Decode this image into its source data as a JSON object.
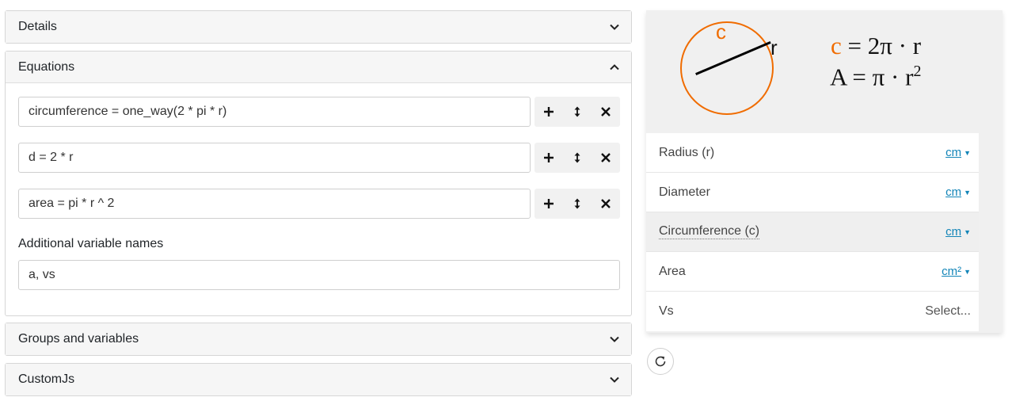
{
  "panels": {
    "details": {
      "title": "Details"
    },
    "equations": {
      "title": "Equations"
    },
    "groups": {
      "title": "Groups and variables"
    },
    "customjs": {
      "title": "CustomJs"
    }
  },
  "equations": [
    {
      "value": "circumference = one_way(2 * pi * r)"
    },
    {
      "value": "d = 2 * r"
    },
    {
      "value": "area = pi * r ^ 2"
    }
  ],
  "additional": {
    "label": "Additional variable names",
    "value": "a, vs"
  },
  "diagram": {
    "c_label": "c",
    "r_label": "r",
    "formula1": {
      "c": "c",
      "rest": " = 2π · r"
    },
    "formula2": {
      "text": "A = π · r",
      "sup": "2"
    },
    "accent_color": "#f06c00"
  },
  "variables": [
    {
      "label": "Radius (r)",
      "unit": "cm",
      "highlighted": false
    },
    {
      "label": "Diameter",
      "unit": "cm",
      "highlighted": false
    },
    {
      "label": "Circumference (c)",
      "unit": "cm",
      "highlighted": true
    },
    {
      "label": "Area",
      "unit": "cm²",
      "highlighted": false
    },
    {
      "label": "Vs",
      "select": "Select...",
      "highlighted": false
    }
  ],
  "icons": {
    "panel_collapsed": "chevron-down-icon",
    "panel_expanded": "chevron-up-icon",
    "add": "plus-icon",
    "move": "move-vertical-icon",
    "remove": "close-icon",
    "refresh": "refresh-icon"
  }
}
